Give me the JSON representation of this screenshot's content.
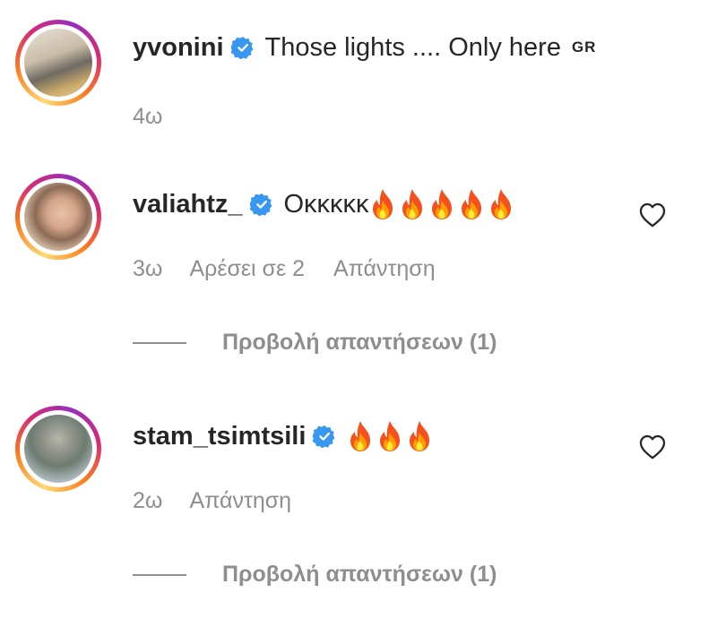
{
  "comments": [
    {
      "username": "yvonini",
      "verified": true,
      "text": "Those lights .... Only here",
      "flag_text": "GR",
      "time": "4ω",
      "likes": "",
      "reply_label": "",
      "view_replies": "",
      "fire_count": 0
    },
    {
      "username": "valiahtz_",
      "verified": true,
      "text": "Οκκκκκ",
      "time": "3ω",
      "likes": "Αρέσει σε 2",
      "reply_label": "Απάντηση",
      "view_replies": "Προβολή απαντήσεων (1)",
      "fire_count": 5
    },
    {
      "username": "stam_tsimtsili",
      "verified": true,
      "text": "",
      "time": "2ω",
      "reply_label": "Απάντηση",
      "view_replies": "Προβολή απαντήσεων (1)",
      "fire_count": 3
    }
  ],
  "icons": {
    "verified": "verified-badge-icon",
    "heart": "heart-outline-icon",
    "fire": "fire-emoji-icon"
  },
  "colors": {
    "verified_blue": "#3897f0",
    "secondary_text": "#8e8e8e",
    "primary_text": "#262626"
  }
}
